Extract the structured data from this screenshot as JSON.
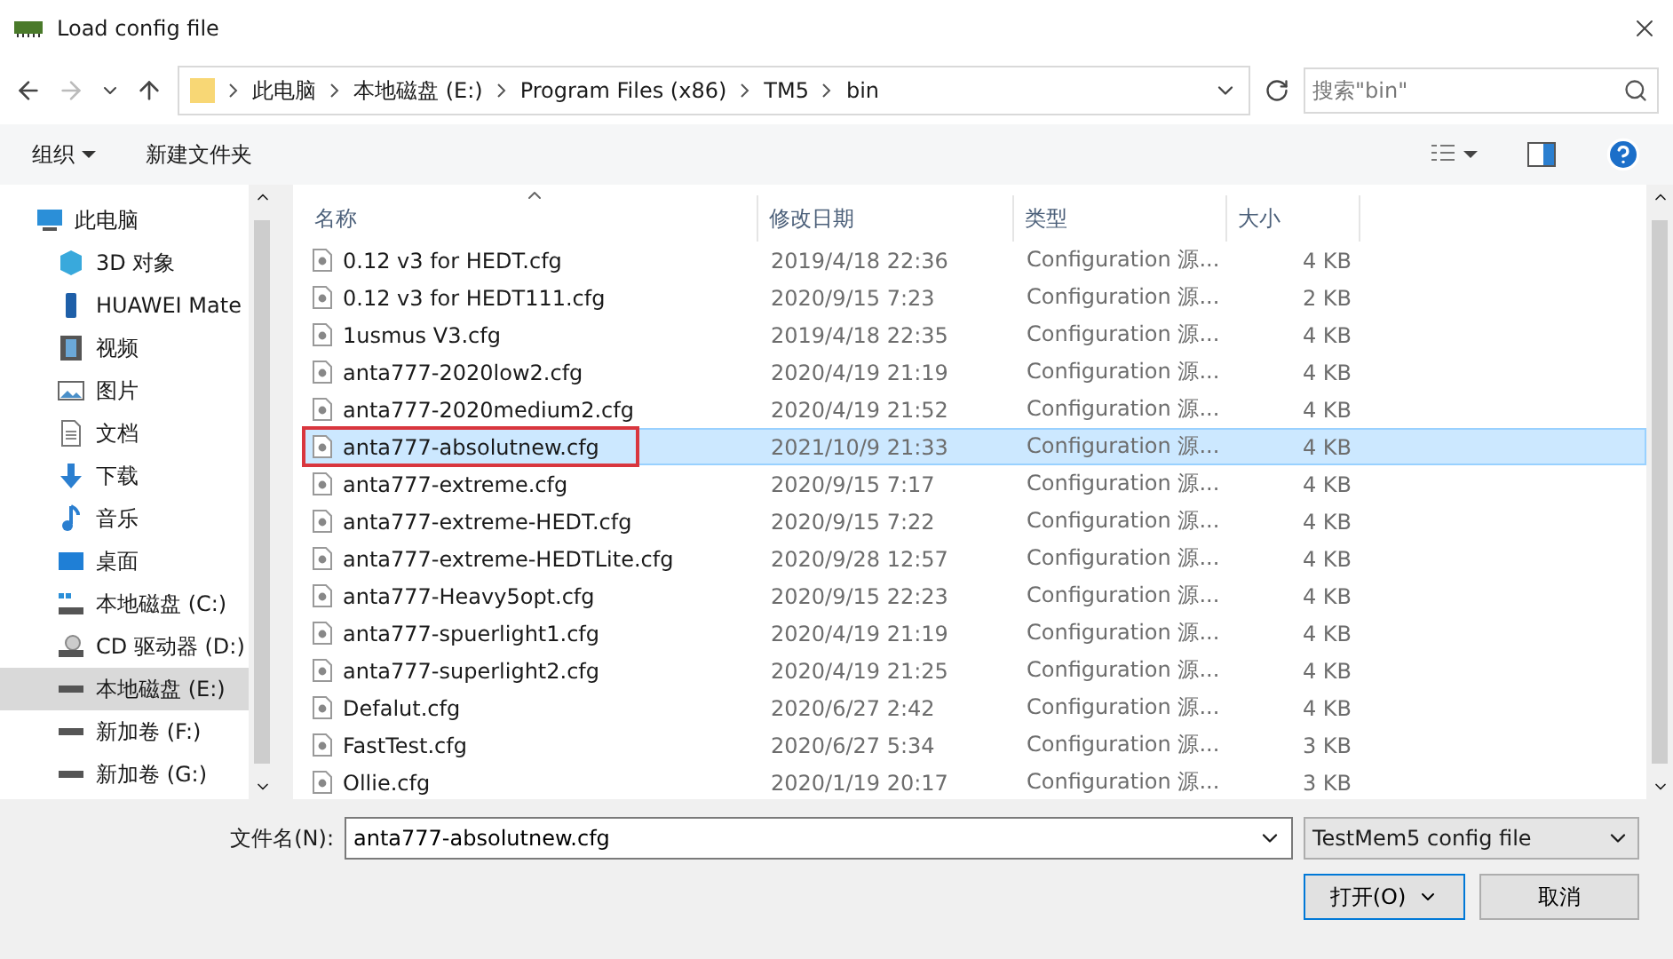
{
  "window": {
    "title": "Load config file"
  },
  "address": {
    "crumbs": [
      "此电脑",
      "本地磁盘 (E:)",
      "Program Files (x86)",
      "TM5",
      "bin"
    ],
    "search_placeholder": "搜索\"bin\""
  },
  "toolbar": {
    "organize": "组织",
    "new_folder": "新建文件夹"
  },
  "sidebar": {
    "items": [
      {
        "label": "此电脑",
        "kind": "pc",
        "selected": false,
        "children": [
          {
            "label": "3D 对象",
            "kind": "cube",
            "selected": false
          },
          {
            "label": "HUAWEI Mate",
            "kind": "phone",
            "selected": false
          },
          {
            "label": "视频",
            "kind": "video",
            "selected": false
          },
          {
            "label": "图片",
            "kind": "picture",
            "selected": false
          },
          {
            "label": "文档",
            "kind": "document",
            "selected": false
          },
          {
            "label": "下载",
            "kind": "download",
            "selected": false
          },
          {
            "label": "音乐",
            "kind": "music",
            "selected": false
          },
          {
            "label": "桌面",
            "kind": "desktop",
            "selected": false
          },
          {
            "label": "本地磁盘 (C:)",
            "kind": "system-drive",
            "selected": false
          },
          {
            "label": "CD 驱动器 (D:)",
            "kind": "cd",
            "selected": false
          },
          {
            "label": "本地磁盘 (E:)",
            "kind": "drive",
            "selected": true
          },
          {
            "label": "新加卷 (F:)",
            "kind": "drive",
            "selected": false
          },
          {
            "label": "新加卷 (G:)",
            "kind": "drive",
            "selected": false
          }
        ]
      }
    ]
  },
  "table": {
    "columns": [
      "名称",
      "修改日期",
      "类型",
      "大小"
    ],
    "rows": [
      {
        "name": "0.12 v3 for HEDT.cfg",
        "date": "2019/4/18 22:36",
        "type": "Configuration 源...",
        "size": "4 KB",
        "selected": false,
        "highlighted": false
      },
      {
        "name": "0.12 v3 for HEDT111.cfg",
        "date": "2020/9/15 7:23",
        "type": "Configuration 源...",
        "size": "2 KB",
        "selected": false,
        "highlighted": false
      },
      {
        "name": "1usmus V3.cfg",
        "date": "2019/4/18 22:35",
        "type": "Configuration 源...",
        "size": "4 KB",
        "selected": false,
        "highlighted": false
      },
      {
        "name": "anta777-2020low2.cfg",
        "date": "2020/4/19 21:19",
        "type": "Configuration 源...",
        "size": "4 KB",
        "selected": false,
        "highlighted": false
      },
      {
        "name": "anta777-2020medium2.cfg",
        "date": "2020/4/19 21:52",
        "type": "Configuration 源...",
        "size": "4 KB",
        "selected": false,
        "highlighted": false
      },
      {
        "name": "anta777-absolutnew.cfg",
        "date": "2021/10/9 21:33",
        "type": "Configuration 源...",
        "size": "4 KB",
        "selected": true,
        "highlighted": true
      },
      {
        "name": "anta777-extreme.cfg",
        "date": "2020/9/15 7:17",
        "type": "Configuration 源...",
        "size": "4 KB",
        "selected": false,
        "highlighted": false
      },
      {
        "name": "anta777-extreme-HEDT.cfg",
        "date": "2020/9/15 7:22",
        "type": "Configuration 源...",
        "size": "4 KB",
        "selected": false,
        "highlighted": false
      },
      {
        "name": "anta777-extreme-HEDTLite.cfg",
        "date": "2020/9/28 12:57",
        "type": "Configuration 源...",
        "size": "4 KB",
        "selected": false,
        "highlighted": false
      },
      {
        "name": "anta777-Heavy5opt.cfg",
        "date": "2020/9/15 22:23",
        "type": "Configuration 源...",
        "size": "4 KB",
        "selected": false,
        "highlighted": false
      },
      {
        "name": "anta777-spuerlight1.cfg",
        "date": "2020/4/19 21:19",
        "type": "Configuration 源...",
        "size": "4 KB",
        "selected": false,
        "highlighted": false
      },
      {
        "name": "anta777-superlight2.cfg",
        "date": "2020/4/19 21:25",
        "type": "Configuration 源...",
        "size": "4 KB",
        "selected": false,
        "highlighted": false
      },
      {
        "name": "Defalut.cfg",
        "date": "2020/6/27 2:42",
        "type": "Configuration 源...",
        "size": "4 KB",
        "selected": false,
        "highlighted": false
      },
      {
        "name": "FastTest.cfg",
        "date": "2020/6/27 5:34",
        "type": "Configuration 源...",
        "size": "3 KB",
        "selected": false,
        "highlighted": false
      },
      {
        "name": "Ollie.cfg",
        "date": "2020/1/19 20:17",
        "type": "Configuration 源...",
        "size": "3 KB",
        "selected": false,
        "highlighted": false
      }
    ]
  },
  "footer": {
    "filename_label": "文件名(N):",
    "filename": "anta777-absolutnew.cfg",
    "filter": "TestMem5 config file",
    "open": "打开(O)",
    "cancel": "取消"
  }
}
